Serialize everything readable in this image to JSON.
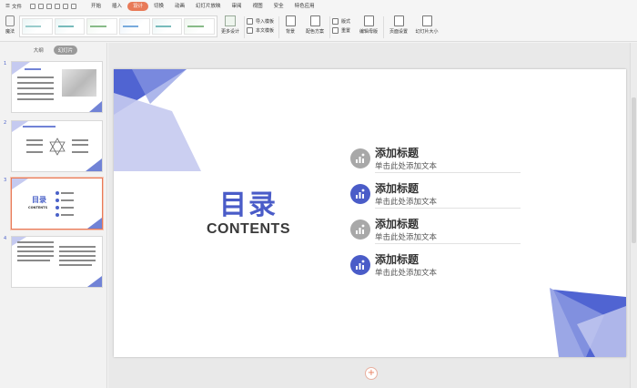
{
  "menubar": {
    "file_label": "文件",
    "items": [
      "开始",
      "插入",
      "设计",
      "切换",
      "动画",
      "幻灯片放映",
      "审阅",
      "视图",
      "安全",
      "特色应用"
    ],
    "active_index": 2
  },
  "ribbon": {
    "magic_label": "魔法",
    "more_design_label": "更多设计",
    "import_template_label": "导入模板",
    "text_template_label": "本文模板",
    "background_label": "背景",
    "color_scheme_label": "配色方案",
    "format_label": "版式",
    "reset_label": "重置",
    "edit_master_label": "编辑母版",
    "page_setup_label": "页面设置",
    "slide_size_label": "幻灯片大小"
  },
  "panel": {
    "tabs": [
      "大纲",
      "幻灯片"
    ],
    "active_tab": 1,
    "slides": [
      {
        "number": "1"
      },
      {
        "number": "2"
      },
      {
        "number": "3",
        "selected": true
      },
      {
        "number": "4"
      }
    ],
    "thumb3_title": "目录",
    "thumb3_sub": "CONTENTS"
  },
  "slide": {
    "title_cn": "目录",
    "title_en": "CONTENTS",
    "items": [
      {
        "title": "添加标题",
        "subtitle": "单击此处添加文本",
        "icon": "chart-people-icon",
        "color": "gray"
      },
      {
        "title": "添加标题",
        "subtitle": "单击此处添加文本",
        "icon": "chart-people-icon",
        "color": "blue"
      },
      {
        "title": "添加标题",
        "subtitle": "单击此处添加文本",
        "icon": "chart-people-icon",
        "color": "gray"
      },
      {
        "title": "添加标题",
        "subtitle": "单击此处添加文本",
        "icon": "chart-people-icon",
        "color": "blue"
      }
    ]
  },
  "colors": {
    "accent_blue": "#4a5cc8",
    "light_blue": "#c5caf0",
    "active_orange": "#e87a58",
    "gray_circle": "#a8a8a8"
  },
  "add_slide_icon": "plus-icon"
}
